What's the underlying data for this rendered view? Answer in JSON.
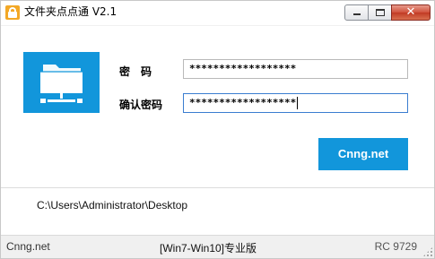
{
  "window": {
    "title": "文件夹点点通 V2.1"
  },
  "title_buttons": {
    "minimize_icon": "minimize-icon",
    "maximize_icon": "maximize-icon",
    "close_icon": "close-icon",
    "close_glyph": "✕"
  },
  "form": {
    "password_label": "密　码",
    "password_value": "******************",
    "confirm_label": "确认密码",
    "confirm_value": "******************"
  },
  "action_button": {
    "label": "Cnng.net"
  },
  "path": {
    "value": "C:\\Users\\Administrator\\Desktop"
  },
  "statusbar": {
    "left": "Cnng.net",
    "center": "[Win7-Win10]专业版",
    "right": "RC 9729"
  },
  "colors": {
    "accent": "#1296db",
    "app_icon": "#f3a826",
    "close_button": "#c13a24"
  }
}
